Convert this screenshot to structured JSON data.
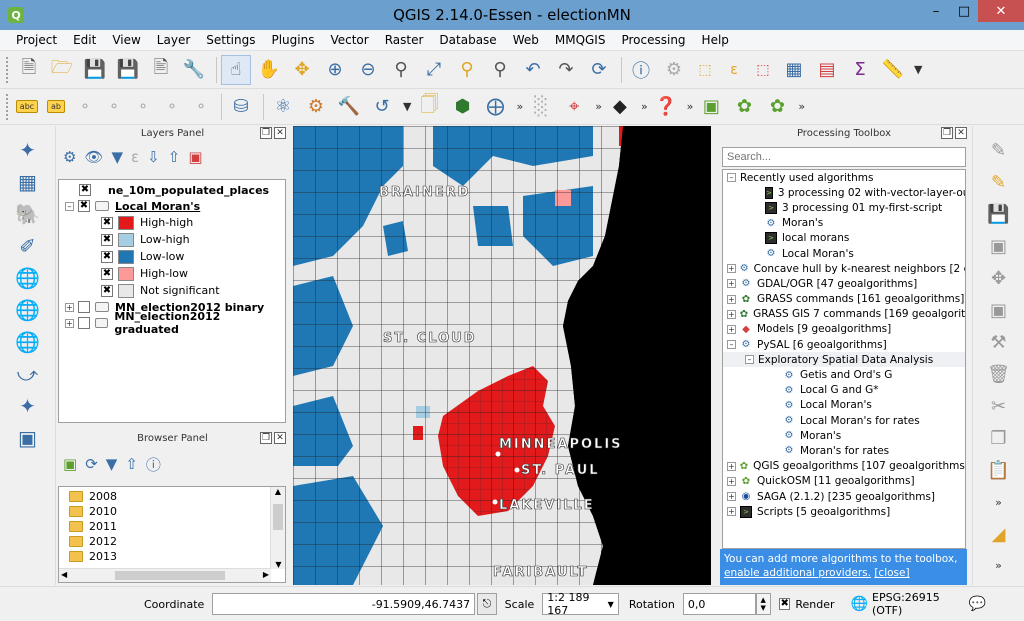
{
  "window": {
    "title": "QGIS 2.14.0-Essen - electionMN",
    "app_icon": "Q"
  },
  "menu": [
    "Project",
    "Edit",
    "View",
    "Layer",
    "Settings",
    "Plugins",
    "Vector",
    "Raster",
    "Database",
    "Web",
    "MMQGIS",
    "Processing",
    "Help"
  ],
  "layers_panel": {
    "title": "Layers Panel",
    "layers": [
      {
        "name": "ne_10m_populated_places",
        "checked": true,
        "active": false
      },
      {
        "name": "Local Moran's",
        "checked": true,
        "active": true
      }
    ],
    "legend": [
      {
        "label": "High-high",
        "color": "#e31a1c"
      },
      {
        "label": "Low-high",
        "color": "#a6cee3"
      },
      {
        "label": "Low-low",
        "color": "#1f78b4"
      },
      {
        "label": "High-low",
        "color": "#fb9a99"
      },
      {
        "label": "Not significant",
        "color": "#e8e8e8"
      }
    ],
    "more_layers": [
      {
        "name": "MN_election2012 binary"
      },
      {
        "name": "MN_election2012 graduated"
      }
    ]
  },
  "browser_panel": {
    "title": "Browser Panel",
    "folders": [
      "2008",
      "2010",
      "2011",
      "2012",
      "2013"
    ]
  },
  "map": {
    "labels": [
      {
        "text": "BRAINERD"
      },
      {
        "text": "ST. CLOUD"
      },
      {
        "text": "MINNEAPOLIS"
      },
      {
        "text": "ST. PAUL"
      },
      {
        "text": "LAKEVILLE"
      },
      {
        "text": "FARIBAULT"
      }
    ]
  },
  "processing": {
    "title": "Processing Toolbox",
    "search_placeholder": "Search...",
    "recent_label": "Recently used algorithms",
    "recent_items": [
      {
        "label": "3 processing 02 with-vector-layer-ou...",
        "icon": "script"
      },
      {
        "label": "3 processing 01 my-first-script",
        "icon": "script"
      },
      {
        "label": "Moran's",
        "icon": "gear"
      },
      {
        "label": "local morans",
        "icon": "script"
      },
      {
        "label": "Local Moran's",
        "icon": "gear"
      }
    ],
    "providers": [
      {
        "label": "Concave hull by k-nearest neighbors [2 g...",
        "icon": "gear"
      },
      {
        "label": "GDAL/OGR [47 geoalgorithms]",
        "icon": "gear"
      },
      {
        "label": "GRASS commands [161 geoalgorithms]",
        "icon": "grass"
      },
      {
        "label": "GRASS GIS 7 commands [169 geoalgorith...",
        "icon": "grass"
      },
      {
        "label": "Models [9 geoalgorithms]",
        "icon": "models"
      },
      {
        "label": "PySAL [6 geoalgorithms]",
        "icon": "gear"
      }
    ],
    "pysal_group": "Exploratory Spatial Data Analysis",
    "pysal_items": [
      "Getis and Ord's G",
      "Local G and G*",
      "Local Moran's",
      "Local Moran's for rates",
      "Moran's",
      "Moran's for rates"
    ],
    "more_providers": [
      {
        "label": "QGIS geoalgorithms [107 geoalgorithms]",
        "icon": "green"
      },
      {
        "label": "QuickOSM [11 geoalgorithms]",
        "icon": "green"
      },
      {
        "label": "SAGA (2.1.2) [235 geoalgorithms]",
        "icon": "saga"
      },
      {
        "label": "Scripts [5 geoalgorithms]",
        "icon": "script"
      }
    ],
    "info_text": "You can add more algorithms to the toolbox,",
    "info_link1": "enable additional providers.",
    "info_link2": "[close]"
  },
  "status": {
    "coordinate_label": "Coordinate",
    "coordinate_value": "-91.5909,46.7437",
    "scale_label": "Scale",
    "scale_value": "1:2 189 167",
    "rotation_label": "Rotation",
    "rotation_value": "0,0",
    "render_label": "Render",
    "render_checked": true,
    "crs": "EPSG:26915 (OTF)"
  }
}
